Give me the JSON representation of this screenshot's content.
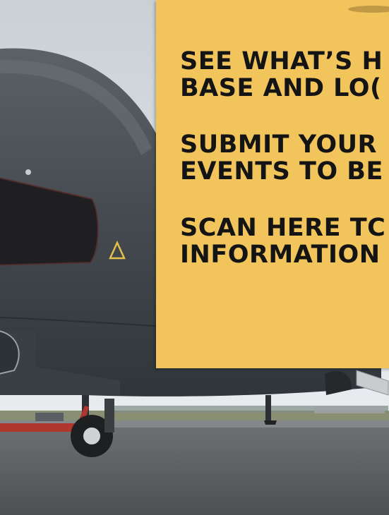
{
  "panel": {
    "lines": [
      "SEE WHAT’S H",
      "BASE AND LO(",
      "SUBMIT YOUR",
      "EVENTS TO BE",
      "SCAN HERE TC",
      "INFORMATION"
    ],
    "background": "#f1c55b"
  },
  "photo": {
    "subject": "drone-aircraft-on-tarmac"
  }
}
